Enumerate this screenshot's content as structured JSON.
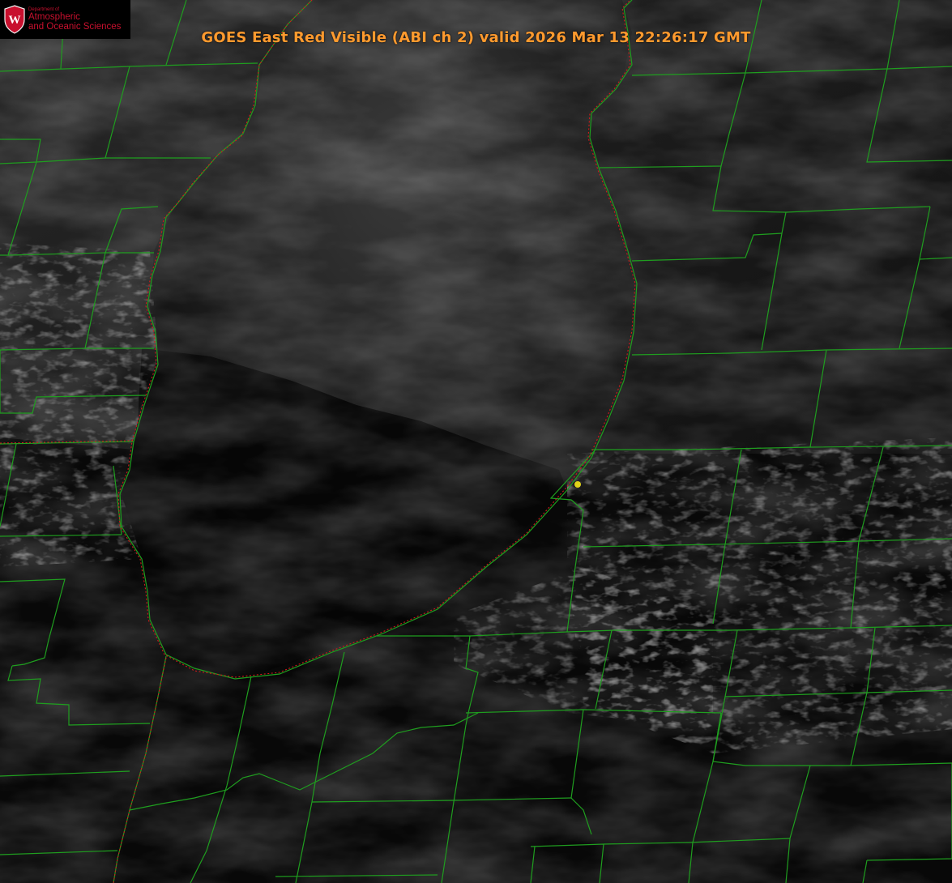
{
  "title": "GOES East Red Visible (ABI ch 2) valid 2026 Mar 13 22:26:17 GMT",
  "logo": {
    "dept_line": "Department of",
    "line1": "Atmospheric",
    "line2": "and Oceanic Sciences",
    "crest_letter": "W",
    "crest_icon": "uw-crest-icon"
  },
  "colors": {
    "title": "#ff9a2e",
    "county_lines": "#1f9e1f",
    "state_border": "#d11a1a",
    "marker": "#e0d21a",
    "logo_red": "#c8102e"
  },
  "marker_icon": "yellow-dot-icon"
}
